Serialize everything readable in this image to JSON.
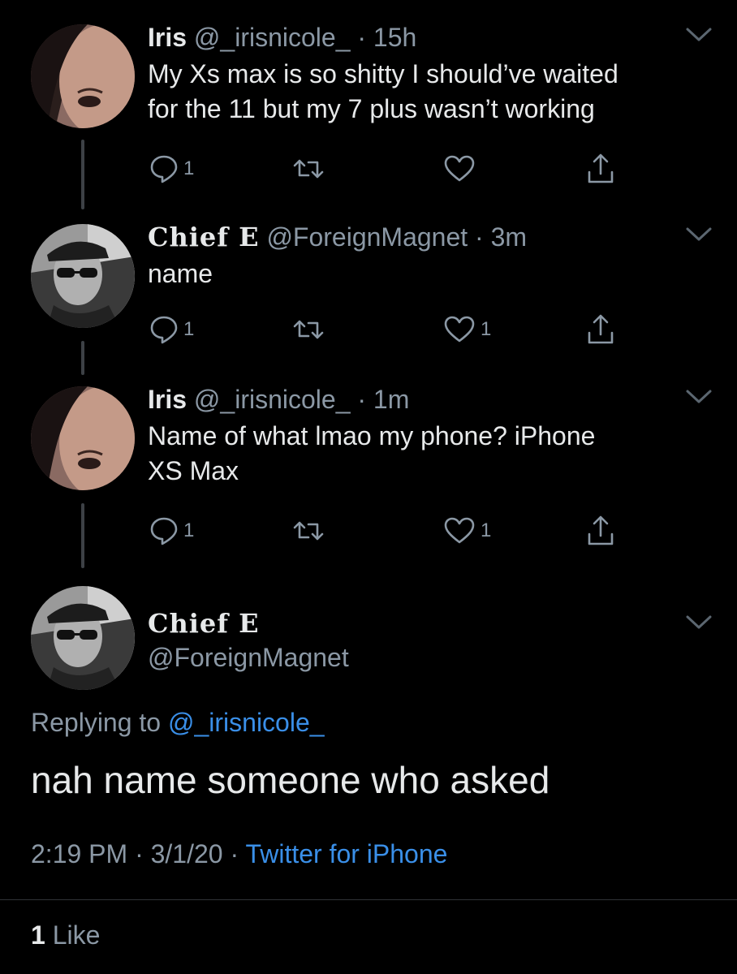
{
  "tweets": [
    {
      "name": "Iris",
      "handle": "@_irisnicole_",
      "separator": "·",
      "time": "15h",
      "text_lines": [
        "My Xs max is so shitty I should’ve waited",
        "for the 11 but my 7 plus wasn’t working"
      ],
      "reply_count": "1",
      "retweet_count": "",
      "like_count": ""
    },
    {
      "name": "Chief E",
      "handle": "@ForeignMagnet",
      "separator": "·",
      "time": "3m",
      "text_lines": [
        "name"
      ],
      "reply_count": "1",
      "retweet_count": "",
      "like_count": "1"
    },
    {
      "name": "Iris",
      "handle": "@_irisnicole_",
      "separator": "·",
      "time": "1m",
      "text_lines": [
        "Name of what lmao my phone? iPhone",
        "XS Max"
      ],
      "reply_count": "1",
      "retweet_count": "",
      "like_count": "1"
    }
  ],
  "main_tweet": {
    "name": "Chief E",
    "handle": "@ForeignMagnet",
    "replying_prefix": "Replying to",
    "replying_handle": "@_irisnicole_",
    "text": "nah name someone who asked",
    "time": "2:19 PM",
    "separator": "·",
    "date": "3/1/20",
    "source": "Twitter for iPhone",
    "like_count": "1",
    "like_label": "Like"
  },
  "colors": {
    "background": "#000000",
    "primary_text": "#e7e9ea",
    "secondary_text": "#8b98a5",
    "link": "#3a8fe8",
    "thread_line": "#3d4146"
  },
  "icons": {
    "reply": "reply-icon",
    "retweet": "retweet-icon",
    "like": "heart-icon",
    "share": "share-icon",
    "more": "chevron-down-icon"
  }
}
